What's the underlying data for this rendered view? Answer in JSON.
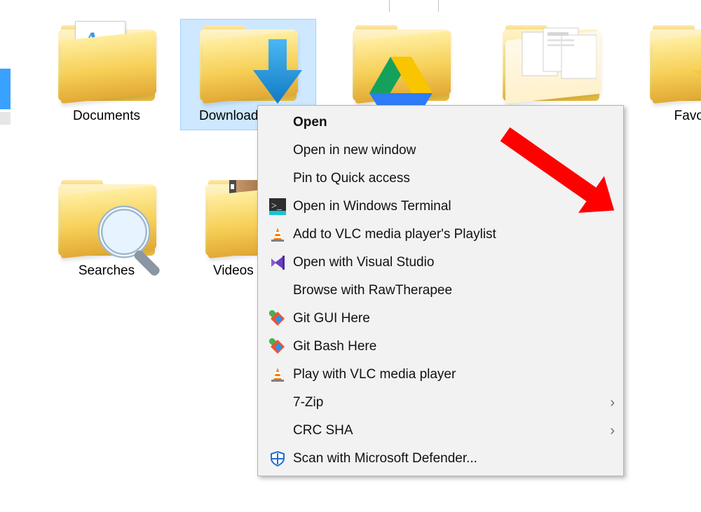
{
  "folders": {
    "documents": {
      "label": "Documents"
    },
    "downloads": {
      "label": "Downloads"
    },
    "googledrive": {
      "label": ""
    },
    "dropbox": {
      "label": ""
    },
    "favourites": {
      "label": "Favourit"
    },
    "searches": {
      "label": "Searches"
    },
    "videos": {
      "label": "Videos"
    }
  },
  "context_menu": [
    {
      "id": "open",
      "label": "Open",
      "icon": "none",
      "bold": true
    },
    {
      "id": "open-new-win",
      "label": "Open in new window",
      "icon": "none"
    },
    {
      "id": "pin-quick",
      "label": "Pin to Quick access",
      "icon": "none"
    },
    {
      "id": "open-terminal",
      "label": "Open in Windows Terminal",
      "icon": "terminal"
    },
    {
      "id": "vlc-playlist",
      "label": "Add to VLC media player's Playlist",
      "icon": "vlc"
    },
    {
      "id": "visual-studio",
      "label": "Open with Visual Studio",
      "icon": "vs"
    },
    {
      "id": "rawtherapee",
      "label": "Browse with RawTherapee",
      "icon": "none"
    },
    {
      "id": "git-gui",
      "label": "Git GUI Here",
      "icon": "git"
    },
    {
      "id": "git-bash",
      "label": "Git Bash Here",
      "icon": "git"
    },
    {
      "id": "vlc-play",
      "label": "Play with VLC media player",
      "icon": "vlc"
    },
    {
      "id": "7zip",
      "label": "7-Zip",
      "icon": "none",
      "submenu": true
    },
    {
      "id": "crc-sha",
      "label": "CRC SHA",
      "icon": "none",
      "submenu": true
    },
    {
      "id": "defender",
      "label": "Scan with Microsoft Defender...",
      "icon": "defender"
    }
  ]
}
